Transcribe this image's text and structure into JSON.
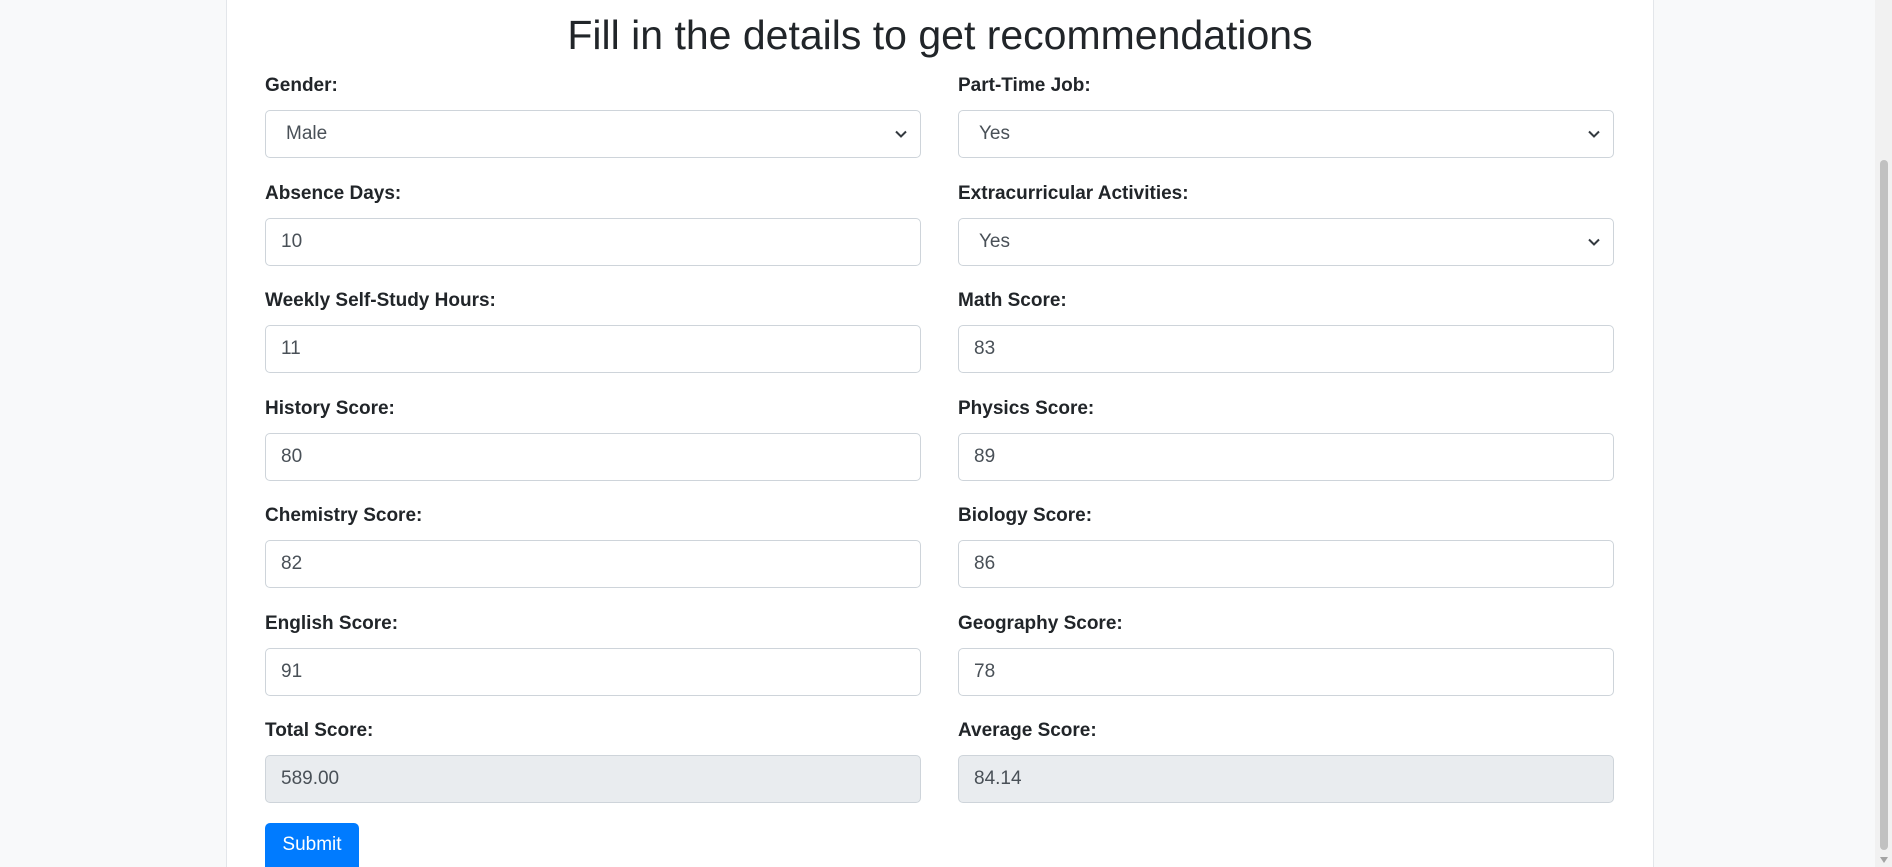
{
  "form": {
    "title": "Fill in the details to get recommendations",
    "gender": {
      "label": "Gender:",
      "value": "Male"
    },
    "part_time_job": {
      "label": "Part-Time Job:",
      "value": "Yes"
    },
    "absence_days": {
      "label": "Absence Days:",
      "value": "10"
    },
    "extracurricular": {
      "label": "Extracurricular Activities:",
      "value": "Yes"
    },
    "weekly_self_study_hours": {
      "label": "Weekly Self-Study Hours:",
      "value": "11"
    },
    "math_score": {
      "label": "Math Score:",
      "value": "83"
    },
    "history_score": {
      "label": "History Score:",
      "value": "80"
    },
    "physics_score": {
      "label": "Physics Score:",
      "value": "89"
    },
    "chemistry_score": {
      "label": "Chemistry Score:",
      "value": "82"
    },
    "biology_score": {
      "label": "Biology Score:",
      "value": "86"
    },
    "english_score": {
      "label": "English Score:",
      "value": "91"
    },
    "geography_score": {
      "label": "Geography Score:",
      "value": "78"
    },
    "total_score": {
      "label": "Total Score:",
      "value": "589.00"
    },
    "average_score": {
      "label": "Average Score:",
      "value": "84.14"
    },
    "submit_label": "Submit"
  },
  "icons": {
    "select_chevron": "chevron-down-icon"
  },
  "colors": {
    "primary": "#007bff",
    "readonly_bg": "#e9ecef",
    "border": "#ced4da"
  }
}
